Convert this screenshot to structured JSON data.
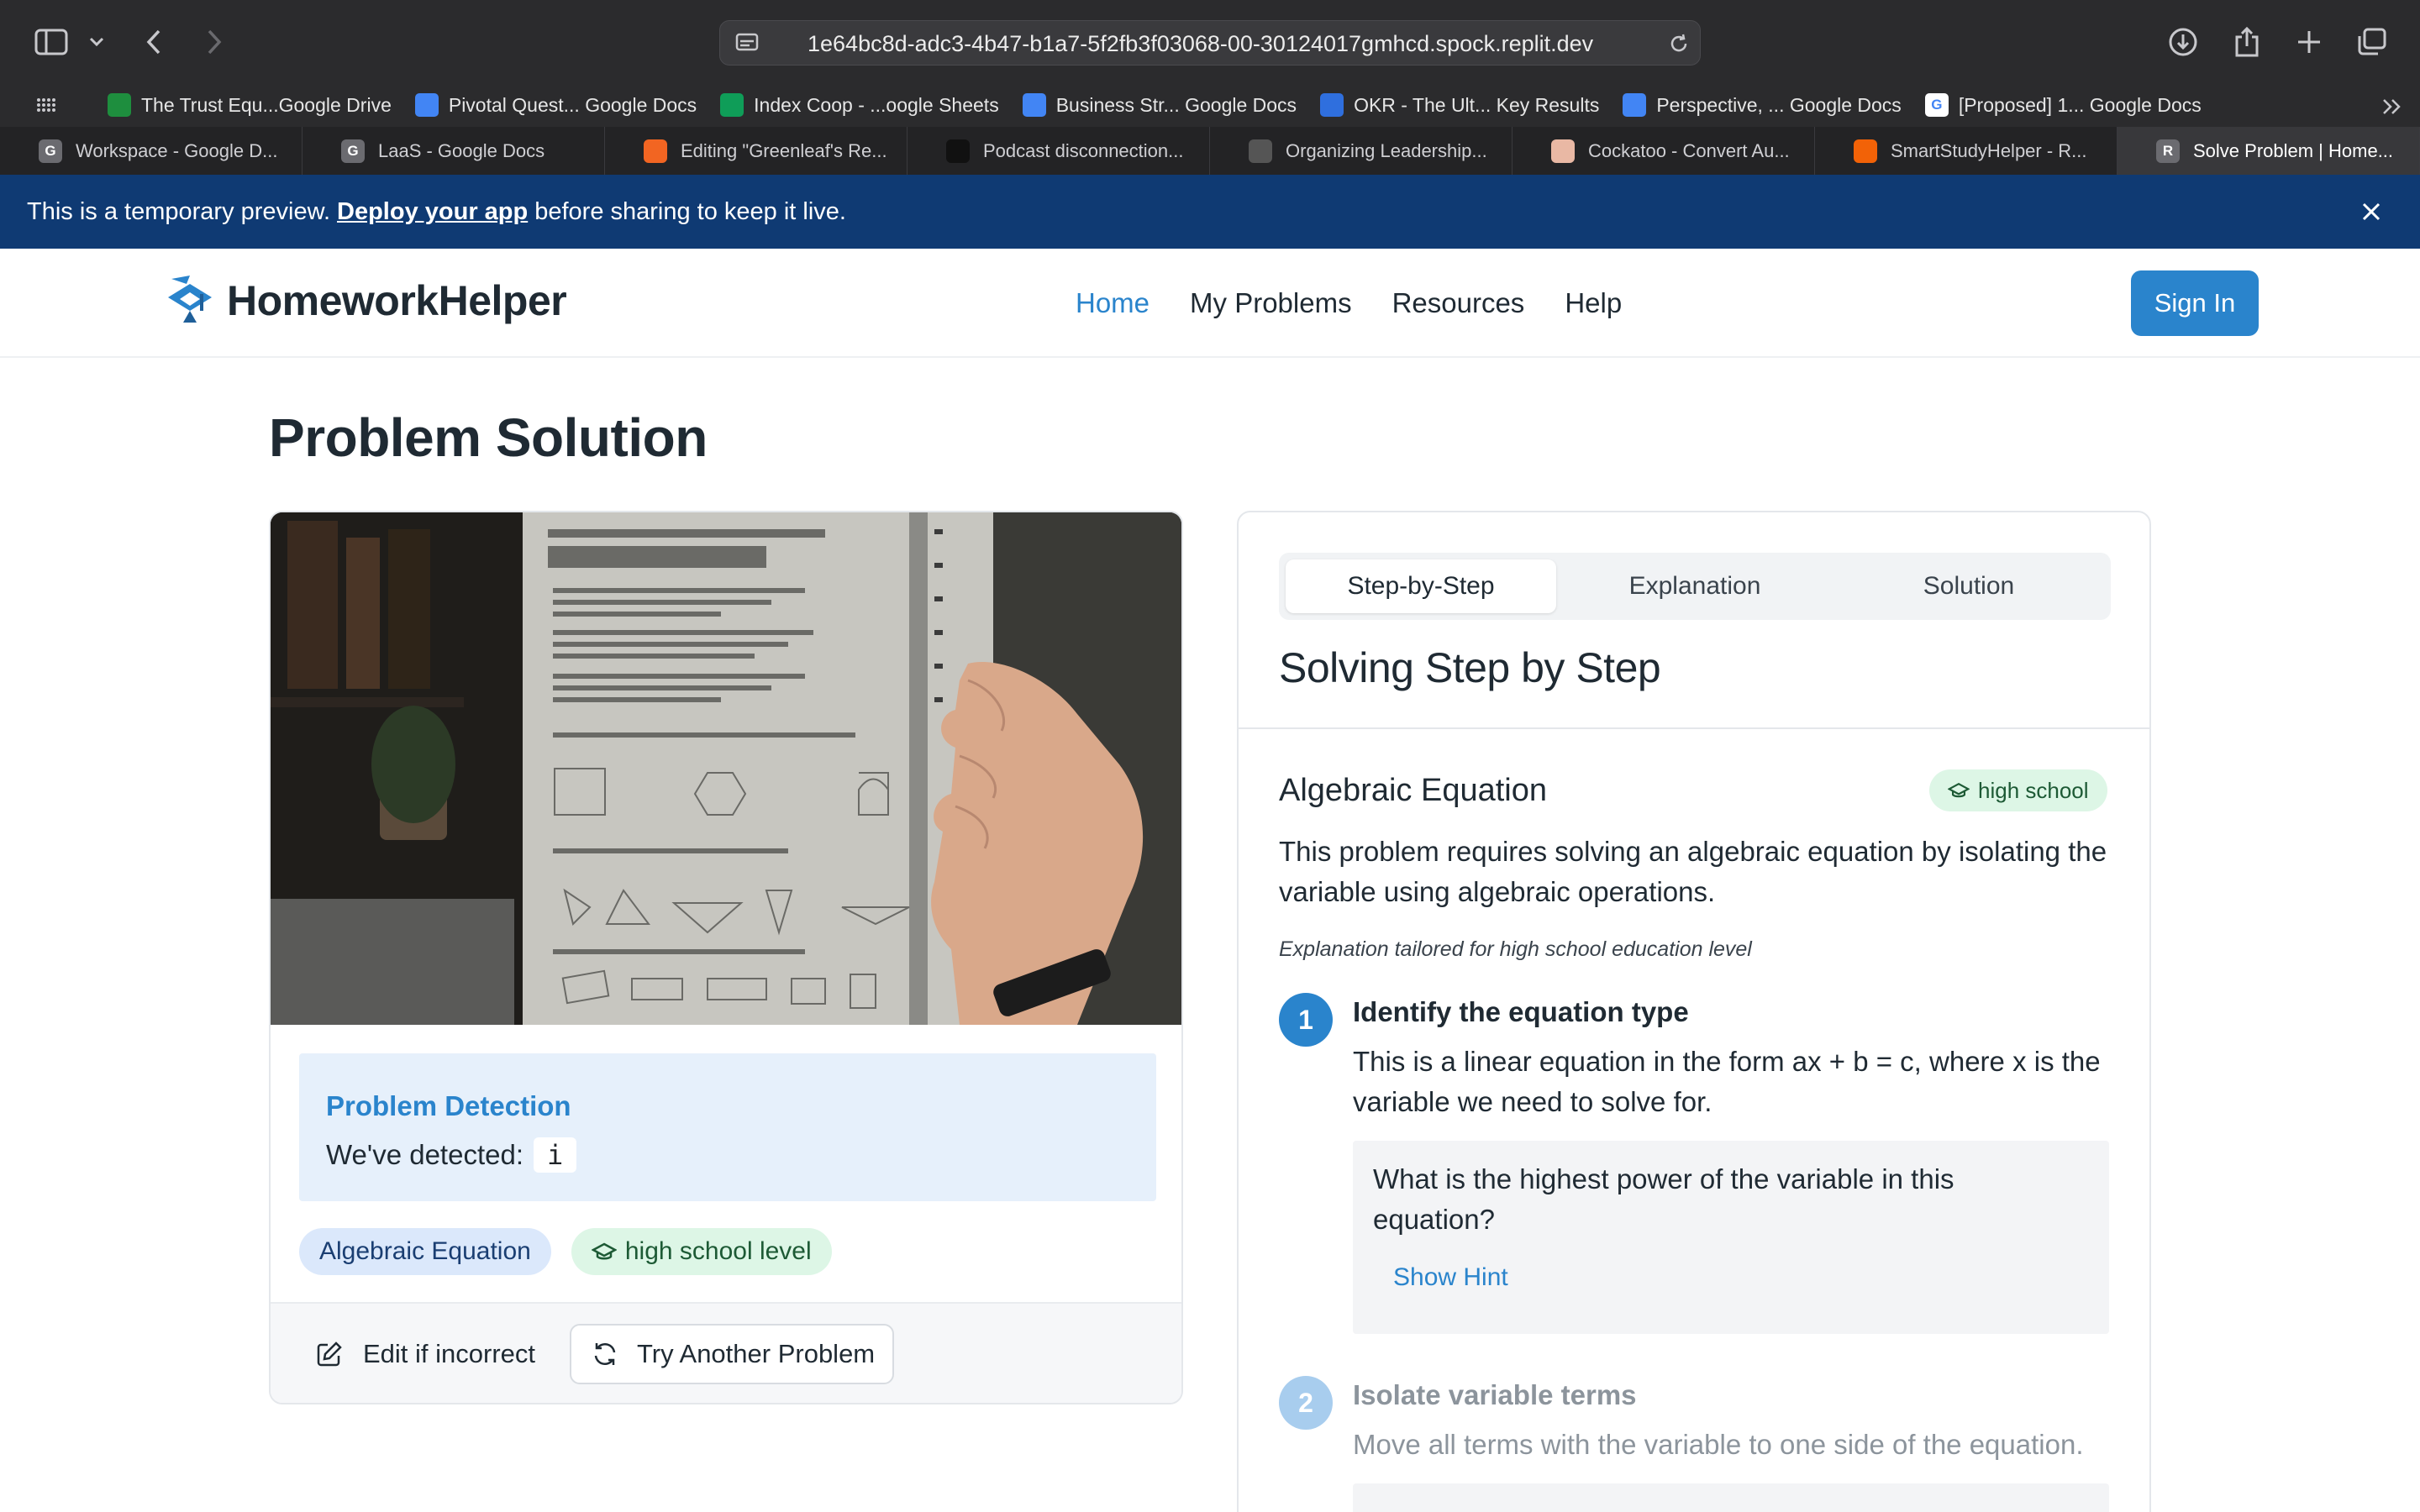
{
  "browser": {
    "url": "1e64bc8d-adc3-4b47-b1a7-5f2fb3f03068-00-30124017gmhcd.spock.replit.dev",
    "bookmarks": [
      {
        "label": "The Trust Equ...Google Drive",
        "color": "#1e8e3e",
        "glyph": ""
      },
      {
        "label": "Pivotal Quest... Google Docs",
        "color": "#4285f4",
        "glyph": ""
      },
      {
        "label": "Index Coop - ...oogle Sheets",
        "color": "#0f9d58",
        "glyph": ""
      },
      {
        "label": "Business Str... Google Docs",
        "color": "#4285f4",
        "glyph": ""
      },
      {
        "label": "OKR - The Ult... Key Results",
        "color": "#2f6fde",
        "glyph": ""
      },
      {
        "label": "Perspective, ... Google Docs",
        "color": "#4285f4",
        "glyph": ""
      },
      {
        "label": "[Proposed] 1... Google Docs",
        "color": "#ffffff",
        "glyph": "G"
      }
    ],
    "tabs": [
      {
        "label": "Workspace - Google D...",
        "color": "#6b6b70",
        "glyph": "G"
      },
      {
        "label": "LaaS - Google Docs",
        "color": "#6b6b70",
        "glyph": "G"
      },
      {
        "label": "Editing \"Greenleaf's Re...",
        "color": "#f26522",
        "glyph": ""
      },
      {
        "label": "Podcast disconnection...",
        "color": "#111111",
        "glyph": ""
      },
      {
        "label": "Organizing Leadership...",
        "color": "#555555",
        "glyph": ""
      },
      {
        "label": "Cockatoo - Convert Au...",
        "color": "#e9b8a4",
        "glyph": ""
      },
      {
        "label": "SmartStudyHelper - R...",
        "color": "#f26207",
        "glyph": ""
      },
      {
        "label": "Solve Problem | Home...",
        "color": "#6b6b70",
        "glyph": "R"
      }
    ]
  },
  "banner": {
    "prefix": "This is a temporary preview.",
    "link": "Deploy your app",
    "suffix": "before sharing to keep it live."
  },
  "nav": {
    "brand": "HomeworkHelper",
    "items": [
      "Home",
      "My Problems",
      "Resources",
      "Help"
    ],
    "active": "Home",
    "sign_in": "Sign In"
  },
  "page": {
    "title": "Problem Solution"
  },
  "detection": {
    "title": "Problem Detection",
    "label": "We've detected:",
    "value": "i"
  },
  "badges": {
    "type": "Algebraic Equation",
    "level": "high school level"
  },
  "actions": {
    "edit": "Edit if incorrect",
    "try_another": "Try Another Problem"
  },
  "solution": {
    "tabs": [
      "Step-by-Step",
      "Explanation",
      "Solution"
    ],
    "active_tab": "Step-by-Step",
    "section_title": "Solving Step by Step",
    "problem_title": "Algebraic Equation",
    "level_badge": "high school",
    "description": "This problem requires solving an algebraic equation by isolating the variable using algebraic operations.",
    "tailored": "Explanation tailored for high school education level",
    "steps": [
      {
        "number": "1",
        "title": "Identify the equation type",
        "desc": "This is a linear equation in the form ax + b = c, where x is the variable we need to solve for.",
        "hint_question": "What is the highest power of the variable in this equation?",
        "hint_button": "Show Hint"
      },
      {
        "number": "2",
        "title": "Isolate variable terms",
        "desc": "Move all terms with the variable to one side of the equation."
      }
    ]
  },
  "colors": {
    "primary": "#2a84cc",
    "banner": "#0f3a73",
    "badge_blue": "#dbe8fb",
    "badge_green": "#ddf6e6",
    "step_active": "#2a84cc",
    "step_inactive": "#a8cdee"
  }
}
